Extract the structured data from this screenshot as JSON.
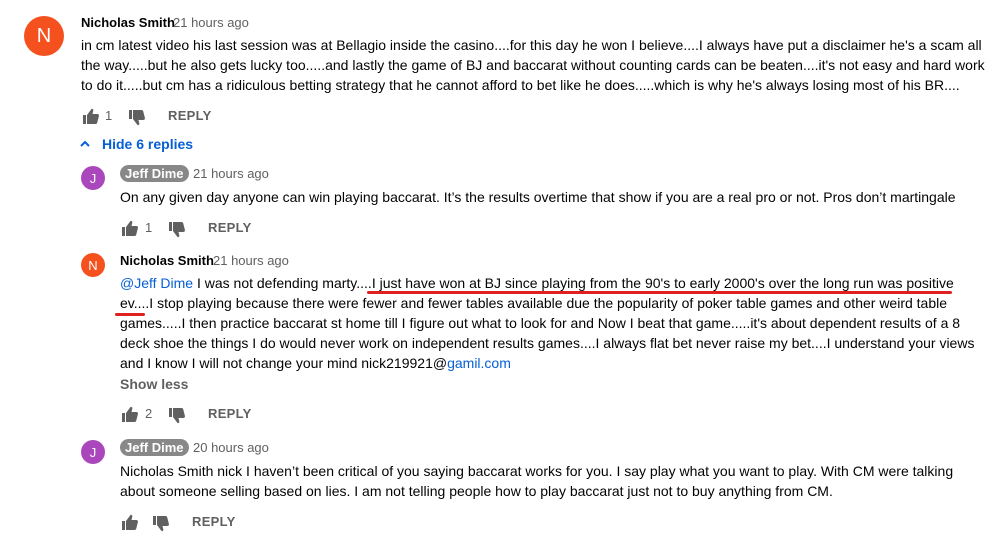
{
  "comments": [
    {
      "author": "Nicholas Smith",
      "time": "21 hours ago",
      "avatar_letter": "N",
      "avatar_color": "#f4511e",
      "lines": [
        "in cm latest video his last session was at Bellagio inside the casino....for this day he won I believe....I always have put a disclaimer he's a scam all",
        "the way.....but he also gets lucky too.....and lastly the game of BJ and baccarat without counting cards can be beaten....it's not easy and hard work",
        "to do it.....but cm has a ridiculous betting strategy that he cannot afford to bet like he does.....which is why he's always losing most of his BR...."
      ],
      "likes": "1",
      "reply_label": "REPLY"
    }
  ],
  "hide_replies_label": "Hide 6 replies",
  "replies": [
    {
      "author": "Jeff Dime",
      "time": "21 hours ago",
      "avatar_letter": "J",
      "avatar_color": "#ab47bc",
      "lines": [
        "On any given day anyone can win playing baccarat. It’s the results overtime that show if you are a real pro or not.  Pros don’t martingale"
      ],
      "likes": "1",
      "reply_label": "REPLY"
    },
    {
      "author": "Nicholas Smith",
      "time": "21 hours ago",
      "avatar_letter": "N",
      "avatar_color": "#f4511e",
      "mention": "@Jeff Dime",
      "line1_rest": " I was not defending marty....I just have won at BJ since playing from the 90's to early 2000's over the long run was positive",
      "lines": [
        "ev....I stop playing because there were fewer and fewer tables available due the popularity of poker table games and other weird table",
        "games.....I then practice baccarat st home till I figure out what to look for and Now I beat that game.....it's about dependent results of a 8",
        "deck shoe the things I do would never work on independent results games....I always flat bet never raise my bet....I understand your views"
      ],
      "last_line_text": "and I know I will not change your mind     nick219921@",
      "last_line_link": "gamil.com",
      "show_less": "Show less",
      "likes": "2",
      "reply_label": "REPLY"
    },
    {
      "author": "Jeff Dime",
      "time": "20 hours ago",
      "avatar_letter": "J",
      "avatar_color": "#ab47bc",
      "lines": [
        "Nicholas Smith nick I haven’t been critical of you saying baccarat works for you.  I say play what you want to play.  With CM were talking",
        "about someone selling based on lies.  I am not telling people how to play baccarat just not to buy anything from CM."
      ],
      "reply_label": "REPLY"
    }
  ],
  "colors": {
    "annotation_underline": "#e02020",
    "link": "#065fd4",
    "secondary_text": "#606060"
  }
}
